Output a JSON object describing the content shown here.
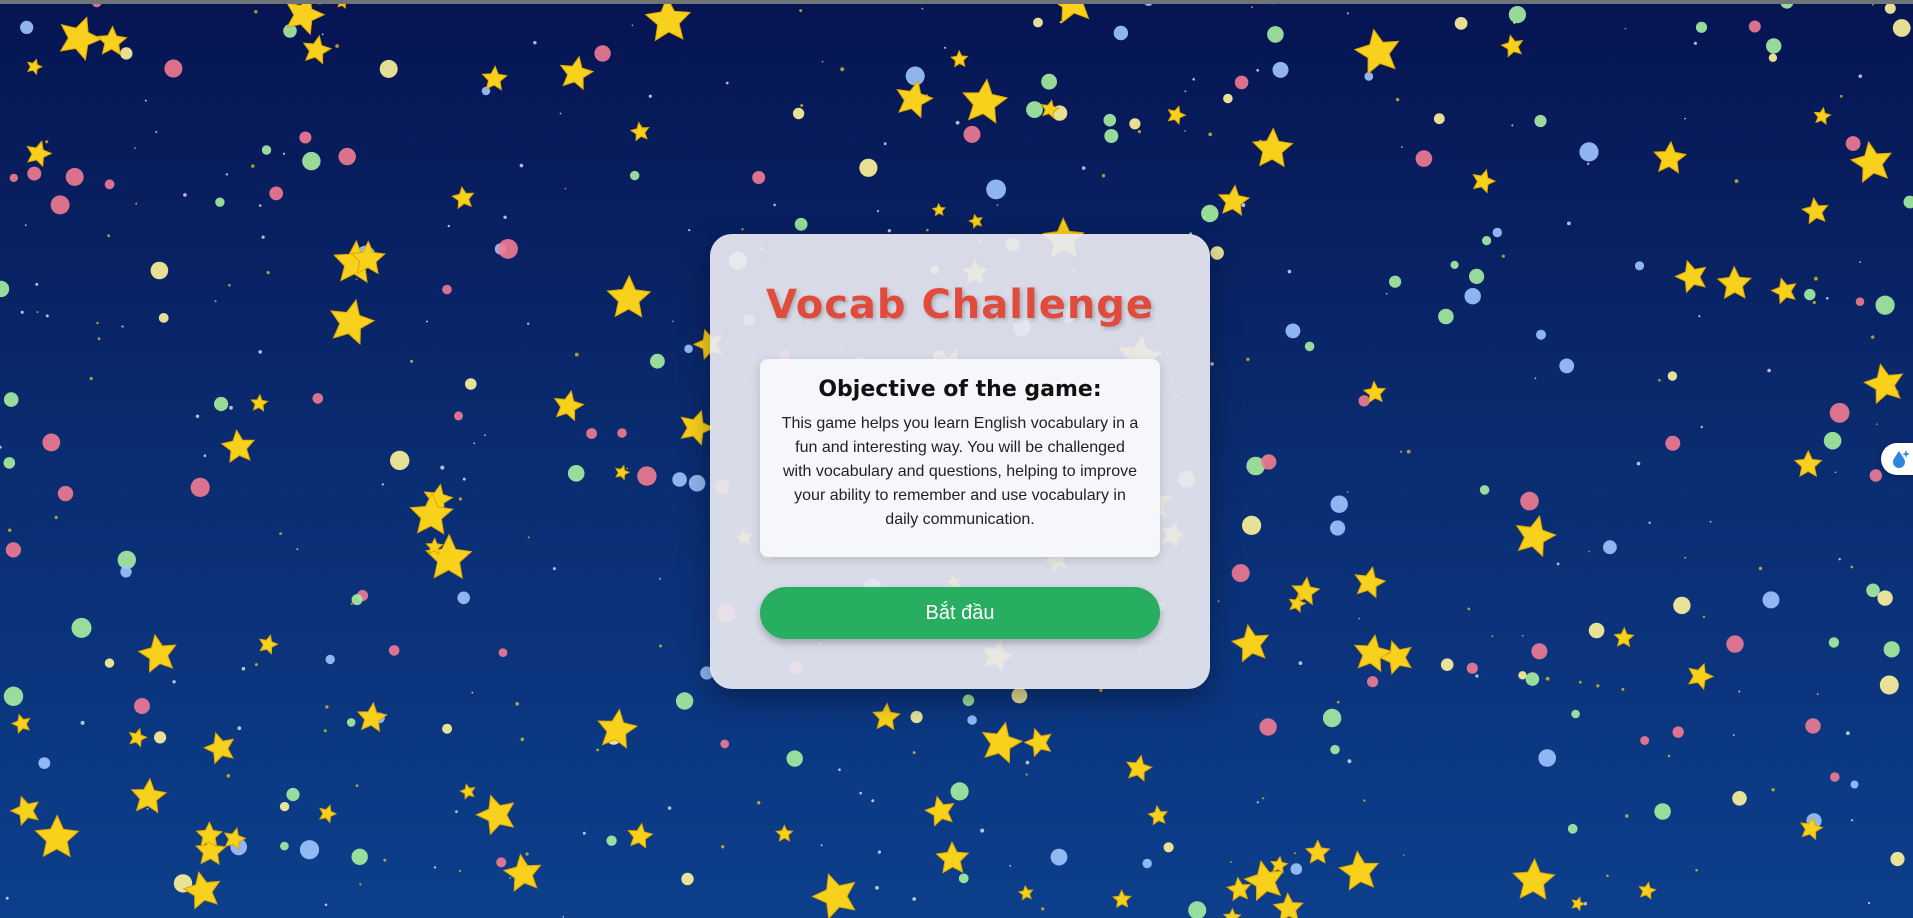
{
  "game": {
    "title": "Vocab Challenge",
    "objective_heading": "Objective of the game:",
    "objective_text": "This game helps you learn English vocabulary in a fun and interesting way. You will be challenged with vocabulary and questions, helping to improve your ability to remember and use vocabulary in daily communication.",
    "start_button_label": "Bắt đầu"
  },
  "background": {
    "decoration": "star-sky",
    "star_color": "#f8d11c",
    "dot_colors": [
      "#f27b92",
      "#a7f0a0",
      "#fff59a",
      "#9ec5ff"
    ]
  },
  "side_widget": {
    "icon": "drop-sparkle-icon"
  },
  "colors": {
    "title": "#e04b3c",
    "start_button": "#27ae60",
    "sky_top": "#061452",
    "sky_bottom": "#0c3f8c"
  }
}
